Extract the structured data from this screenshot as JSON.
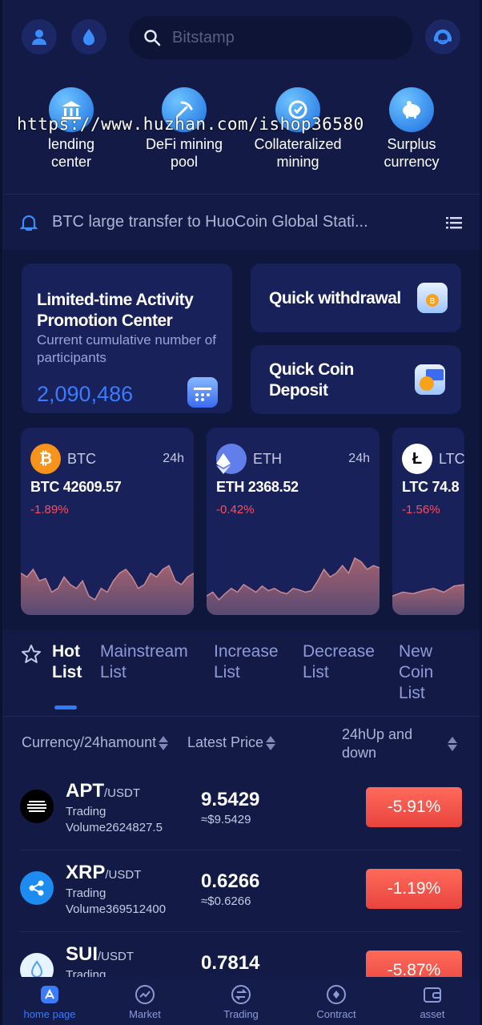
{
  "search": {
    "placeholder": "Bitstamp"
  },
  "features": [
    {
      "label": "lending\ncenter",
      "icon": "bank-icon"
    },
    {
      "label": "DeFi mining\npool",
      "icon": "mining-icon"
    },
    {
      "label": "Collateralized\nmining",
      "icon": "collateral-icon"
    },
    {
      "label": "Surplus\ncurrency",
      "icon": "piggy-bank-icon"
    }
  ],
  "watermark": "https://www.huzhan.com/ishop36580",
  "notice": {
    "text": "BTC large transfer to HuoCoin Global Stati..."
  },
  "promo": {
    "title": "Limited-time Activity Promotion Center",
    "subtitle": "Current cumulative number of participants",
    "count": "2,090,486",
    "withdraw": "Quick withdrawal",
    "deposit": "Quick Coin Deposit"
  },
  "coins": [
    {
      "symbol": "BTC",
      "period": "24h",
      "price": "BTC 42609.57",
      "change": "-1.89%",
      "color": "#f7931a",
      "spark": [
        0.55,
        0.5,
        0.6,
        0.45,
        0.48,
        0.3,
        0.35,
        0.5,
        0.4,
        0.35,
        0.45,
        0.25,
        0.2,
        0.35,
        0.3,
        0.45,
        0.55,
        0.6,
        0.5,
        0.35,
        0.4,
        0.55,
        0.5,
        0.6,
        0.65,
        0.45,
        0.4,
        0.5,
        0.55
      ]
    },
    {
      "symbol": "ETH",
      "period": "24h",
      "price": "ETH 2368.52",
      "change": "-0.42%",
      "color": "#627eea",
      "spark": [
        0.25,
        0.3,
        0.2,
        0.28,
        0.35,
        0.3,
        0.4,
        0.35,
        0.3,
        0.38,
        0.32,
        0.35,
        0.3,
        0.28,
        0.35,
        0.33,
        0.3,
        0.32,
        0.45,
        0.6,
        0.5,
        0.55,
        0.65,
        0.55,
        0.75,
        0.7,
        0.6,
        0.65,
        0.62
      ]
    },
    {
      "symbol": "LTC",
      "period": "24h",
      "price": "LTC 74.8",
      "change": "-1.56%",
      "color": "#ffffff",
      "spark": [
        0.25,
        0.3,
        0.28,
        0.32,
        0.35,
        0.3,
        0.38,
        0.4
      ]
    }
  ],
  "tabs": [
    {
      "label": "Hot\nList",
      "active": true
    },
    {
      "label": "Mainstream\nList",
      "active": false
    },
    {
      "label": "Increase\nList",
      "active": false
    },
    {
      "label": "Decrease\nList",
      "active": false
    },
    {
      "label": "New\nCoin\nList",
      "active": false
    }
  ],
  "list_header": {
    "currency": "Currency/24hamount",
    "price": "Latest Price",
    "change": "24hUp and down"
  },
  "rows": [
    {
      "base": "APT",
      "quote": "/USDT",
      "volume": "Trading Volume2624827.5",
      "price": "9.5429",
      "usd": "≈$9.5429",
      "change": "-5.91%",
      "logo_color": "#000000"
    },
    {
      "base": "XRP",
      "quote": "/USDT",
      "volume": "Trading Volume369512400",
      "price": "0.6266",
      "usd": "≈$0.6266",
      "change": "-1.19%",
      "logo_color": "#1d8cf0"
    },
    {
      "base": "SUI",
      "quote": "/USDT",
      "volume": "Trading",
      "price": "0.7814",
      "usd": "",
      "change": "-5.87%",
      "logo_color": "#e7f3ff"
    }
  ],
  "nav": [
    {
      "label": "home page",
      "icon": "home-icon",
      "active": true
    },
    {
      "label": "Market",
      "icon": "market-icon",
      "active": false
    },
    {
      "label": "Trading",
      "icon": "trading-icon",
      "active": false
    },
    {
      "label": "Contract",
      "icon": "contract-icon",
      "active": false
    },
    {
      "label": "asset",
      "icon": "wallet-icon",
      "active": false
    }
  ],
  "colors": {
    "accent": "#3a7bff",
    "negative": "#ff4d5e",
    "background": "#121a45",
    "card": "#18215a"
  }
}
